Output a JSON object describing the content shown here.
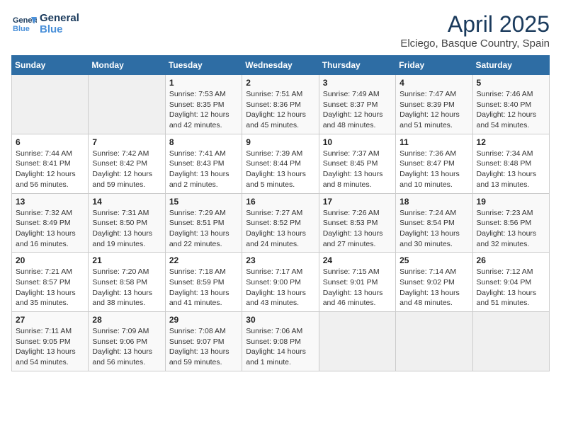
{
  "logo": {
    "line1": "General",
    "line2": "Blue"
  },
  "title": "April 2025",
  "location": "Elciego, Basque Country, Spain",
  "days_of_week": [
    "Sunday",
    "Monday",
    "Tuesday",
    "Wednesday",
    "Thursday",
    "Friday",
    "Saturday"
  ],
  "weeks": [
    [
      {
        "day": "",
        "info": ""
      },
      {
        "day": "",
        "info": ""
      },
      {
        "day": "1",
        "info": "Sunrise: 7:53 AM\nSunset: 8:35 PM\nDaylight: 12 hours and 42 minutes."
      },
      {
        "day": "2",
        "info": "Sunrise: 7:51 AM\nSunset: 8:36 PM\nDaylight: 12 hours and 45 minutes."
      },
      {
        "day": "3",
        "info": "Sunrise: 7:49 AM\nSunset: 8:37 PM\nDaylight: 12 hours and 48 minutes."
      },
      {
        "day": "4",
        "info": "Sunrise: 7:47 AM\nSunset: 8:39 PM\nDaylight: 12 hours and 51 minutes."
      },
      {
        "day": "5",
        "info": "Sunrise: 7:46 AM\nSunset: 8:40 PM\nDaylight: 12 hours and 54 minutes."
      }
    ],
    [
      {
        "day": "6",
        "info": "Sunrise: 7:44 AM\nSunset: 8:41 PM\nDaylight: 12 hours and 56 minutes."
      },
      {
        "day": "7",
        "info": "Sunrise: 7:42 AM\nSunset: 8:42 PM\nDaylight: 12 hours and 59 minutes."
      },
      {
        "day": "8",
        "info": "Sunrise: 7:41 AM\nSunset: 8:43 PM\nDaylight: 13 hours and 2 minutes."
      },
      {
        "day": "9",
        "info": "Sunrise: 7:39 AM\nSunset: 8:44 PM\nDaylight: 13 hours and 5 minutes."
      },
      {
        "day": "10",
        "info": "Sunrise: 7:37 AM\nSunset: 8:45 PM\nDaylight: 13 hours and 8 minutes."
      },
      {
        "day": "11",
        "info": "Sunrise: 7:36 AM\nSunset: 8:47 PM\nDaylight: 13 hours and 10 minutes."
      },
      {
        "day": "12",
        "info": "Sunrise: 7:34 AM\nSunset: 8:48 PM\nDaylight: 13 hours and 13 minutes."
      }
    ],
    [
      {
        "day": "13",
        "info": "Sunrise: 7:32 AM\nSunset: 8:49 PM\nDaylight: 13 hours and 16 minutes."
      },
      {
        "day": "14",
        "info": "Sunrise: 7:31 AM\nSunset: 8:50 PM\nDaylight: 13 hours and 19 minutes."
      },
      {
        "day": "15",
        "info": "Sunrise: 7:29 AM\nSunset: 8:51 PM\nDaylight: 13 hours and 22 minutes."
      },
      {
        "day": "16",
        "info": "Sunrise: 7:27 AM\nSunset: 8:52 PM\nDaylight: 13 hours and 24 minutes."
      },
      {
        "day": "17",
        "info": "Sunrise: 7:26 AM\nSunset: 8:53 PM\nDaylight: 13 hours and 27 minutes."
      },
      {
        "day": "18",
        "info": "Sunrise: 7:24 AM\nSunset: 8:54 PM\nDaylight: 13 hours and 30 minutes."
      },
      {
        "day": "19",
        "info": "Sunrise: 7:23 AM\nSunset: 8:56 PM\nDaylight: 13 hours and 32 minutes."
      }
    ],
    [
      {
        "day": "20",
        "info": "Sunrise: 7:21 AM\nSunset: 8:57 PM\nDaylight: 13 hours and 35 minutes."
      },
      {
        "day": "21",
        "info": "Sunrise: 7:20 AM\nSunset: 8:58 PM\nDaylight: 13 hours and 38 minutes."
      },
      {
        "day": "22",
        "info": "Sunrise: 7:18 AM\nSunset: 8:59 PM\nDaylight: 13 hours and 41 minutes."
      },
      {
        "day": "23",
        "info": "Sunrise: 7:17 AM\nSunset: 9:00 PM\nDaylight: 13 hours and 43 minutes."
      },
      {
        "day": "24",
        "info": "Sunrise: 7:15 AM\nSunset: 9:01 PM\nDaylight: 13 hours and 46 minutes."
      },
      {
        "day": "25",
        "info": "Sunrise: 7:14 AM\nSunset: 9:02 PM\nDaylight: 13 hours and 48 minutes."
      },
      {
        "day": "26",
        "info": "Sunrise: 7:12 AM\nSunset: 9:04 PM\nDaylight: 13 hours and 51 minutes."
      }
    ],
    [
      {
        "day": "27",
        "info": "Sunrise: 7:11 AM\nSunset: 9:05 PM\nDaylight: 13 hours and 54 minutes."
      },
      {
        "day": "28",
        "info": "Sunrise: 7:09 AM\nSunset: 9:06 PM\nDaylight: 13 hours and 56 minutes."
      },
      {
        "day": "29",
        "info": "Sunrise: 7:08 AM\nSunset: 9:07 PM\nDaylight: 13 hours and 59 minutes."
      },
      {
        "day": "30",
        "info": "Sunrise: 7:06 AM\nSunset: 9:08 PM\nDaylight: 14 hours and 1 minute."
      },
      {
        "day": "",
        "info": ""
      },
      {
        "day": "",
        "info": ""
      },
      {
        "day": "",
        "info": ""
      }
    ]
  ]
}
